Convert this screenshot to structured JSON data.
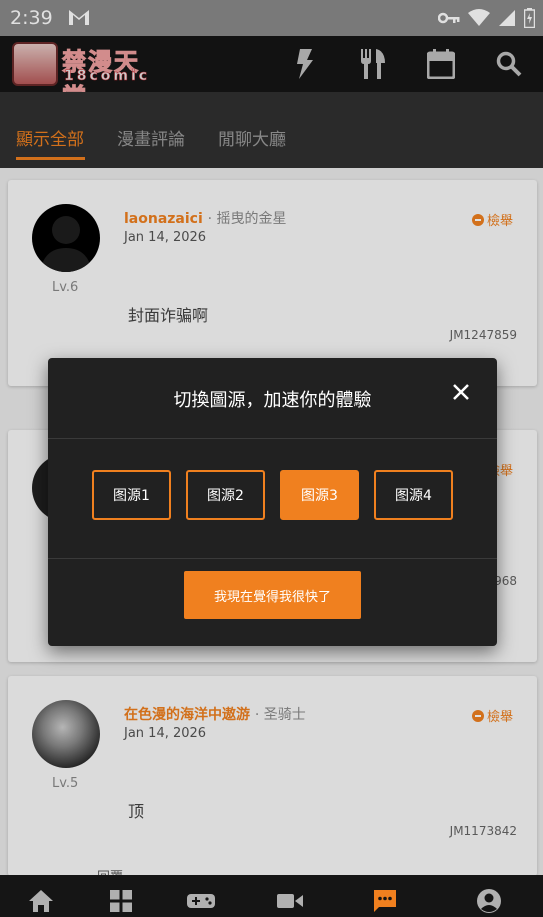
{
  "status_bar": {
    "time": "2:39"
  },
  "app": {
    "logo_line1": "禁漫天堂",
    "logo_line2": "18comic"
  },
  "tabs": [
    {
      "label": "顯示全部",
      "active": true
    },
    {
      "label": "漫畫評論",
      "active": false
    },
    {
      "label": "閒聊大廳",
      "active": false
    }
  ],
  "comments": [
    {
      "username": "laonazaici",
      "rank": "· 摇曳的金星",
      "date": "Jan 14, 2026",
      "level": "Lv.6",
      "text": "封面诈骗啊",
      "report": "檢舉",
      "id": "JM1247859"
    },
    {
      "report": "檢舉",
      "id_partial": "968"
    },
    {
      "username": "在色漫的海洋中遨游",
      "rank": "· 圣骑士",
      "date": "Jan 14, 2026",
      "level": "Lv.5",
      "text": "顶",
      "report": "檢舉",
      "id": "JM1173842"
    }
  ],
  "peek_text": "回覆",
  "dialog": {
    "title": "切換圖源，加速你的體驗",
    "sources": [
      {
        "label": "图源1",
        "selected": false
      },
      {
        "label": "图源2",
        "selected": false
      },
      {
        "label": "图源3",
        "selected": true
      },
      {
        "label": "图源4",
        "selected": false
      }
    ],
    "confirm_label": "我現在覺得我很快了"
  },
  "colors": {
    "accent": "#f0801f",
    "bar": "#151515",
    "tabbar": "#303030",
    "dialog": "#212121"
  }
}
